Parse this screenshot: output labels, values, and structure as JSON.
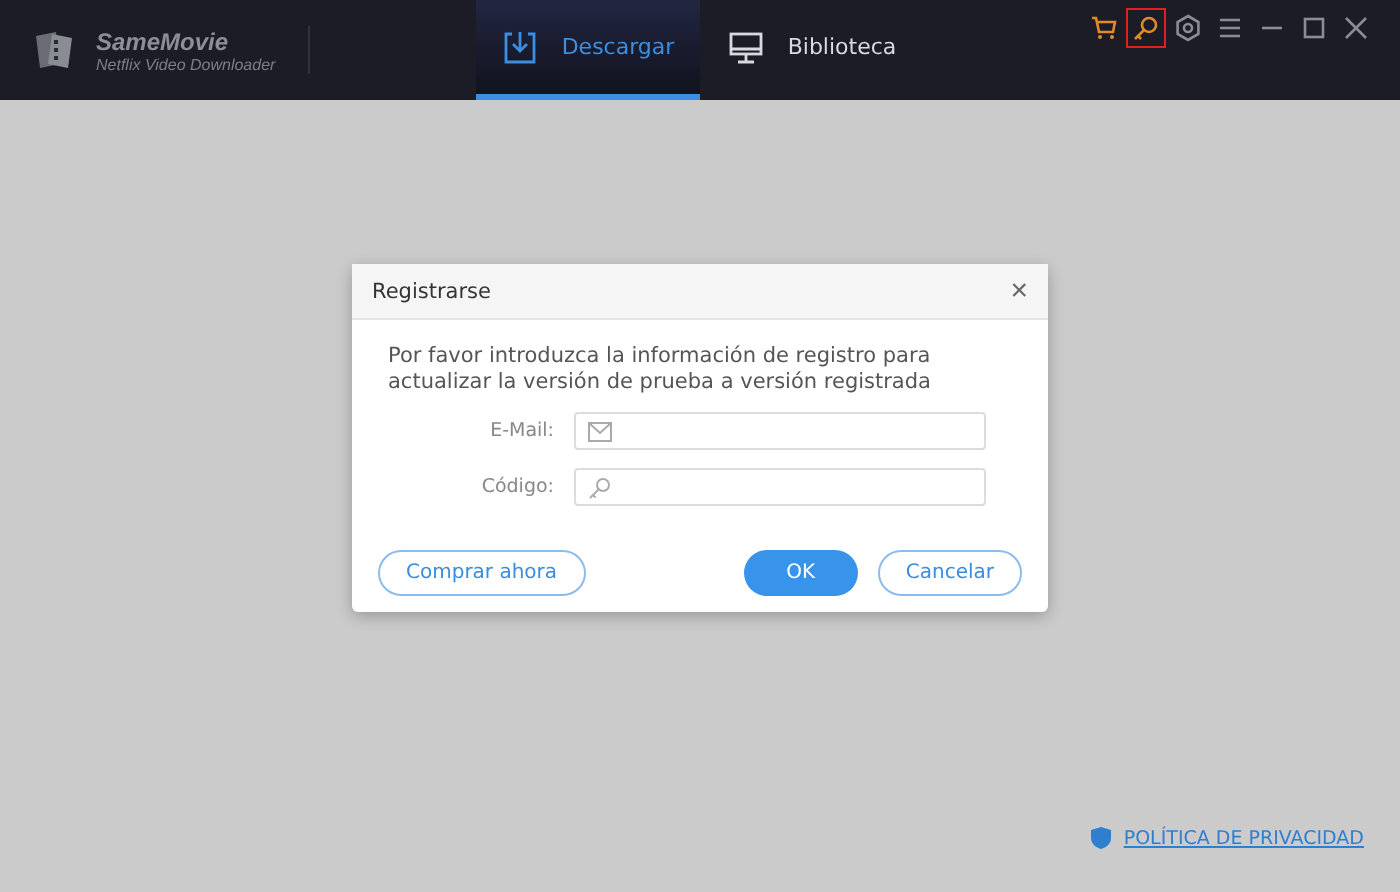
{
  "app": {
    "name": "SameMovie",
    "subtitle": "Netflix Video Downloader"
  },
  "tabs": [
    {
      "label": "Descargar",
      "selected": true,
      "kind": "download"
    },
    {
      "label": "Biblioteca",
      "selected": false,
      "kind": "library"
    }
  ],
  "toolbar": [
    {
      "kind": "cart",
      "selected": false
    },
    {
      "kind": "key",
      "selected": true
    },
    {
      "kind": "settings",
      "selected": false
    },
    {
      "kind": "menu",
      "selected": false
    },
    {
      "kind": "minimize",
      "selected": false
    },
    {
      "kind": "maximize",
      "selected": false
    },
    {
      "kind": "close",
      "selected": false
    }
  ],
  "dialog": {
    "title": "Registrarse",
    "close": "×",
    "message": "Por favor introduzca la información de registro para actualizar la versión de prueba a versión registrada",
    "fields": [
      {
        "label": "E-Mail:",
        "kind": "email"
      },
      {
        "label": "Código:",
        "kind": "key"
      }
    ],
    "buy_button": "Comprar ahora",
    "ok_button": "OK",
    "cancel_button": "Cancelar"
  },
  "privacy_link": "POLÍTICA DE PRIVACIDAD"
}
